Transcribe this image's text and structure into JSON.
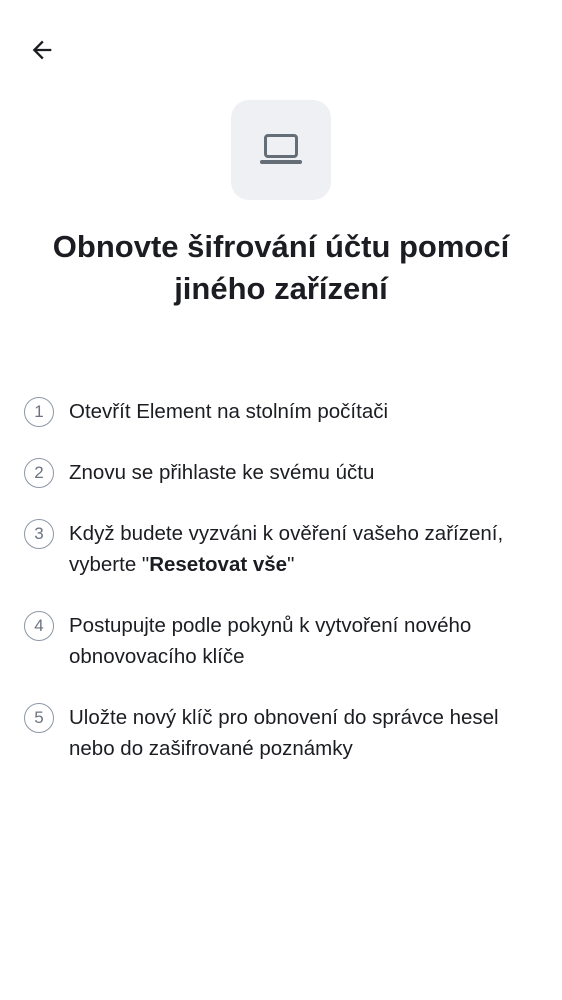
{
  "header": {
    "back_icon": "arrow-left-icon"
  },
  "hero": {
    "icon": "laptop-icon",
    "title": "Obnovte šifrování účtu pomocí jiného zařízení"
  },
  "steps": [
    {
      "number": "1",
      "text": "Otevřít Element na stolním počítači"
    },
    {
      "number": "2",
      "text": "Znovu se přihlaste ke svému účtu"
    },
    {
      "number": "3",
      "text_before": "Když budete vyzváni k ověření vašeho zařízení, vyberte \"",
      "text_bold": "Resetovat vše",
      "text_after": "\""
    },
    {
      "number": "4",
      "text": "Postupujte podle pokynů k vytvoření nového obnovovacího klíče"
    },
    {
      "number": "5",
      "text": "Uložte nový klíč pro obnovení do správce hesel nebo do zašifrované poznámky"
    }
  ]
}
